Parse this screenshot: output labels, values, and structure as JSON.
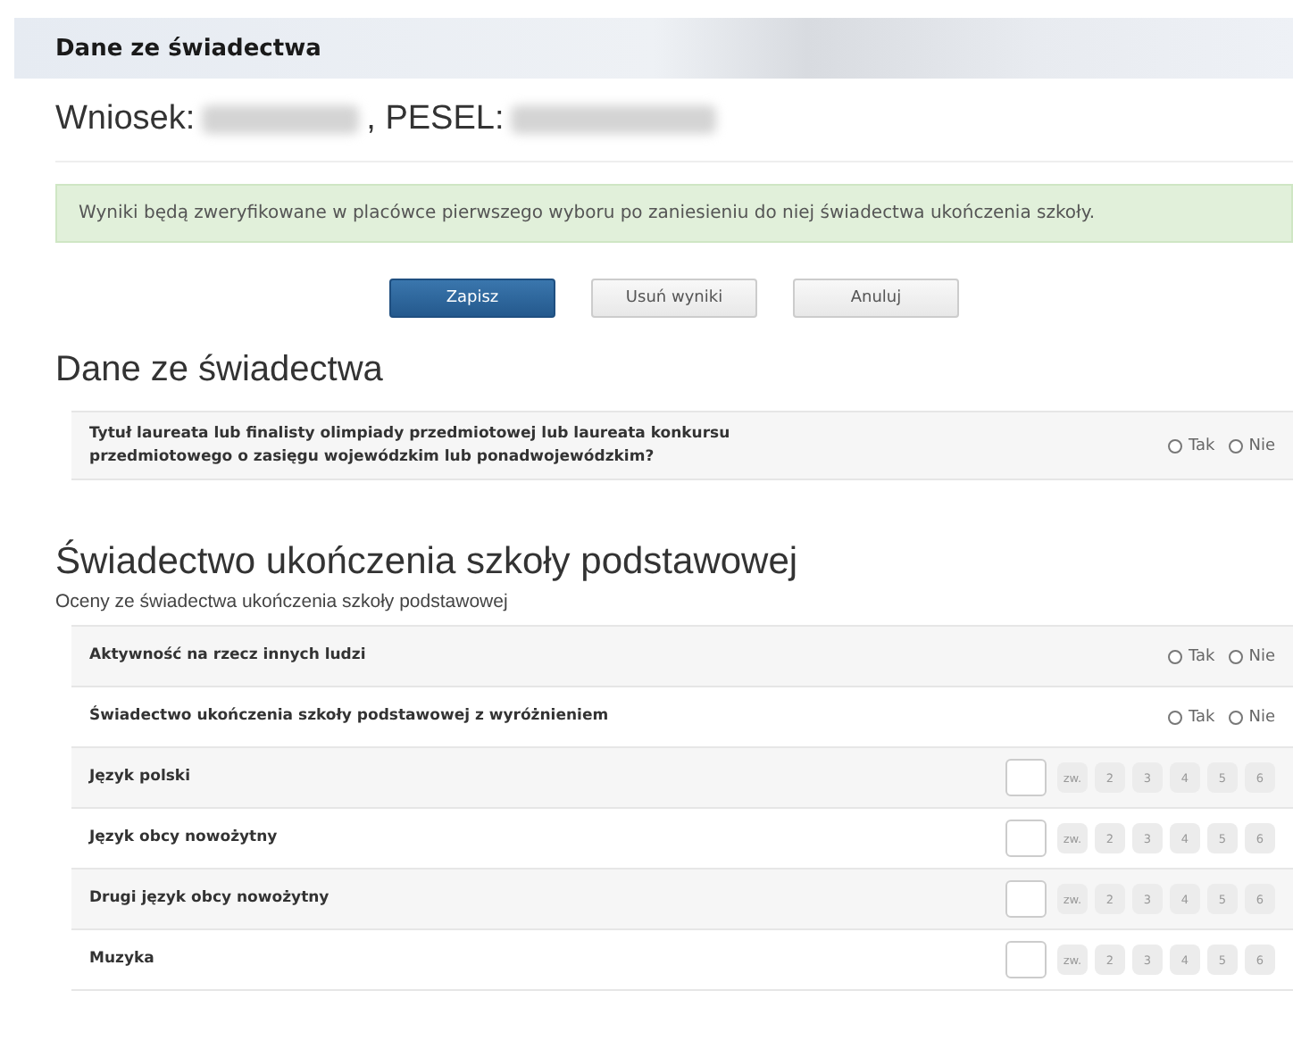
{
  "header": {
    "title": "Dane ze świadectwa"
  },
  "application": {
    "label": "Wniosek:",
    "separator": ", PESEL:"
  },
  "alert": {
    "text": "Wyniki będą zweryfikowane w placówce pierwszego wyboru po zaniesieniu do niej świadectwa ukończenia szkoły."
  },
  "buttons": [
    {
      "label": "Zapisz",
      "kind": "primary"
    },
    {
      "label": "Usuń wyniki",
      "kind": "default"
    },
    {
      "label": "Anuluj",
      "kind": "default"
    }
  ],
  "sections": [
    {
      "title": "Dane ze świadectwa",
      "rows": [
        {
          "kind": "yesno",
          "label": "Tytuł laureata lub finalisty olimpiady przedmiotowej lub laureata konkursu przedmiotowego o zasięgu wojewódzkim lub ponadwojewódzkim?",
          "options": [
            {
              "label": "Tak",
              "selected": false
            },
            {
              "label": "Nie",
              "selected": false
            }
          ]
        }
      ]
    },
    {
      "title": "Świadectwo ukończenia szkoły podstawowej",
      "subtitle": "Oceny ze świadectwa ukończenia szkoły podstawowej",
      "rows": [
        {
          "kind": "yesno",
          "label": "Aktywność na rzecz innych ludzi",
          "options": [
            {
              "label": "Tak",
              "selected": false
            },
            {
              "label": "Nie",
              "selected": false
            }
          ]
        },
        {
          "kind": "yesno",
          "label": "Świadectwo ukończenia szkoły podstawowej z wyróżnieniem",
          "options": [
            {
              "label": "Tak",
              "selected": false
            },
            {
              "label": "Nie",
              "selected": false
            }
          ]
        },
        {
          "kind": "grade",
          "label": "Język polski",
          "grades": [
            {
              "label": "zw.",
              "selected": false
            },
            {
              "label": "2",
              "selected": false
            },
            {
              "label": "3",
              "selected": false
            },
            {
              "label": "4",
              "selected": false
            },
            {
              "label": "5",
              "selected": false
            },
            {
              "label": "6",
              "selected": false
            }
          ]
        },
        {
          "kind": "grade",
          "label": "Język obcy nowożytny",
          "grades": [
            {
              "label": "zw.",
              "selected": false
            },
            {
              "label": "2",
              "selected": false
            },
            {
              "label": "3",
              "selected": false
            },
            {
              "label": "4",
              "selected": false
            },
            {
              "label": "5",
              "selected": false
            },
            {
              "label": "6",
              "selected": false
            }
          ]
        },
        {
          "kind": "grade",
          "label": "Drugi język obcy nowożytny",
          "grades": [
            {
              "label": "zw.",
              "selected": false
            },
            {
              "label": "2",
              "selected": false
            },
            {
              "label": "3",
              "selected": false
            },
            {
              "label": "4",
              "selected": false
            },
            {
              "label": "5",
              "selected": false
            },
            {
              "label": "6",
              "selected": false
            }
          ]
        },
        {
          "kind": "grade",
          "label": "Muzyka",
          "grades": [
            {
              "label": "zw.",
              "selected": false
            },
            {
              "label": "2",
              "selected": false
            },
            {
              "label": "3",
              "selected": false
            },
            {
              "label": "4",
              "selected": false
            },
            {
              "label": "5",
              "selected": false
            },
            {
              "label": "6",
              "selected": false
            }
          ]
        }
      ]
    }
  ]
}
